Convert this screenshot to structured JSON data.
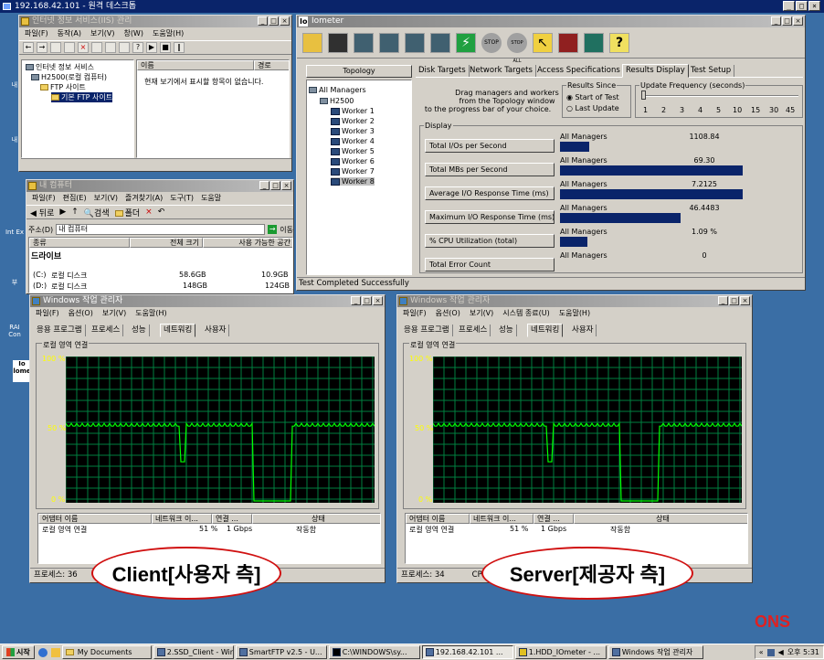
{
  "rdp_title": "192.168.42.101 - 원격 데스크톱",
  "iis": {
    "title": "인터넷 정보 서비스(IIS) 관리",
    "menu": [
      "파일(F)",
      "동작(A)",
      "보기(V)",
      "창(W)",
      "도움말(H)"
    ],
    "tree": [
      "인터넷 정보 서비스",
      "H2500(로컬 컴퓨터)",
      "FTP 사이트",
      "기본 FTP 사이트"
    ],
    "columns": [
      "이름",
      "경로"
    ],
    "empty_message": "현재 보기에서 표시할 항목이 없습니다."
  },
  "mycomputer": {
    "title": "내 컴퓨터",
    "menu": [
      "파일(F)",
      "편집(E)",
      "보기(V)",
      "즐겨찾기(A)",
      "도구(T)",
      "도움말"
    ],
    "back": "뒤로",
    "search": "검색",
    "folders": "폴더",
    "address_label": "주소(D)",
    "address_value": "내 컴퓨터",
    "go": "이동",
    "columns": [
      "종류",
      "전체 크기",
      "사용 가능한 공간"
    ],
    "section": "드라이브",
    "drives": [
      {
        "name": "(C:)",
        "type": "로컬 디스크",
        "total": "58.6GB",
        "free": "10.9GB"
      },
      {
        "name": "(D:)",
        "type": "로컬 디스크",
        "total": "148GB",
        "free": "124GB"
      }
    ]
  },
  "iometer": {
    "title": "Iometer",
    "title_badge": "Io",
    "toolbar_icons": [
      "open-icon",
      "save-icon",
      "display-icon",
      "disk-icon",
      "network-icon",
      "copy-icon",
      "start-icon",
      "stop-icon",
      "stop-all-icon",
      "reset-icon",
      "workers-icon",
      "exit-icon",
      "help-icon"
    ],
    "topology_label": "Topology",
    "tree_root": "All Managers",
    "manager": "H2500",
    "workers": [
      "Worker 1",
      "Worker 2",
      "Worker 3",
      "Worker 4",
      "Worker 5",
      "Worker 6",
      "Worker 7",
      "Worker 8"
    ],
    "tabs": [
      "Disk Targets",
      "Network Targets",
      "Access Specifications",
      "Results Display",
      "Test Setup"
    ],
    "selected_tab": "Results Display",
    "drag_hint_1": "Drag managers and workers",
    "drag_hint_2": "from the Topology window",
    "drag_hint_3": "to the progress bar of your choice.",
    "results_since_label": "Results Since",
    "results_since_options": [
      "Start of Test",
      "Last Update"
    ],
    "update_freq_label": "Update Frequency (seconds)",
    "update_freq_ticks": [
      "1",
      "2",
      "3",
      "4",
      "5",
      "10",
      "15",
      "30",
      "45"
    ],
    "display_label": "Display",
    "metrics": [
      {
        "button": "Total I/Os per Second",
        "scope": "All Managers",
        "value": "1108.84",
        "fill": 0.16
      },
      {
        "button": "Total MBs per Second",
        "scope": "All Managers",
        "value": "69.30",
        "fill": 1.0
      },
      {
        "button": "Average I/O Response Time (ms)",
        "scope": "All Managers",
        "value": "7.2125",
        "fill": 1.0
      },
      {
        "button": "Maximum I/O Response Time (ms)",
        "scope": "All Managers",
        "value": "46.4483",
        "fill": 0.66
      },
      {
        "button": "% CPU Utilization (total)",
        "scope": "All Managers",
        "value": "1.09 %",
        "fill": 0.15
      },
      {
        "button": "Total Error Count",
        "scope": "All Managers",
        "value": "0",
        "fill": 0
      }
    ],
    "status": "Test Completed Successfully"
  },
  "taskmgr_left": {
    "title": "Windows 작업 관리자",
    "menu": [
      "파일(F)",
      "옵션(O)",
      "보기(V)",
      "도움말(H)"
    ],
    "tabs": [
      "응용 프로그램",
      "프로세스",
      "성능",
      "네트워킹",
      "사용자"
    ],
    "selected_tab": "네트워킹",
    "graph_title": "로컬 영역 연결",
    "y_ticks": [
      "100 %",
      "50 %",
      "0 %"
    ],
    "columns": [
      "어댑터 이름",
      "네트워크 이...",
      "연결 ...",
      "상태"
    ],
    "row": [
      "로컬 영역 연결",
      "51 %",
      "1 Gbps",
      "작동함"
    ],
    "status": "프로세스: 36",
    "label": "Client[사용자 측]"
  },
  "taskmgr_right": {
    "title": "Windows 작업 관리자",
    "menu": [
      "파일(F)",
      "옵션(O)",
      "보기(V)",
      "시스템 종료(U)",
      "도움말(H)"
    ],
    "tabs": [
      "응용 프로그램",
      "프로세스",
      "성능",
      "네트워킹",
      "사용자"
    ],
    "selected_tab": "네트워킹",
    "graph_title": "로컬 영역 연결",
    "y_ticks": [
      "100 %",
      "50 %",
      "0 %"
    ],
    "columns": [
      "어댑터 이름",
      "네트워크 이...",
      "연결 ...",
      "상태"
    ],
    "row": [
      "로컬 영역 연결",
      "51 %",
      "1 Gbps",
      "작동함"
    ],
    "status": "프로세스: 34",
    "cpu_label": "CPU",
    "label": "Server[제공자 측]"
  },
  "desktop_icons": [
    "내",
    "내",
    "Int Ex",
    "부",
    "RAI Con",
    "Io lome"
  ],
  "watermark": "ONS",
  "taskbar": {
    "start": "시작",
    "items": [
      "My Documents",
      "2.SSD_Client - Win...",
      "SmartFTP v2.5 - U...",
      "C:\\WINDOWS\\sy...",
      "192.168.42.101 ...",
      "1.HDD_IOmeter - ...",
      "Windows 작업 관리자"
    ],
    "active_index": 4,
    "clock": "오후 5:31"
  },
  "colors": {
    "desktop": "#3a6ea5",
    "titlebar": "#0a246a",
    "graph_line": "#00ff00",
    "graph_grid": "#008040",
    "oval_border": "#d01010",
    "watermark": "#e02020"
  }
}
